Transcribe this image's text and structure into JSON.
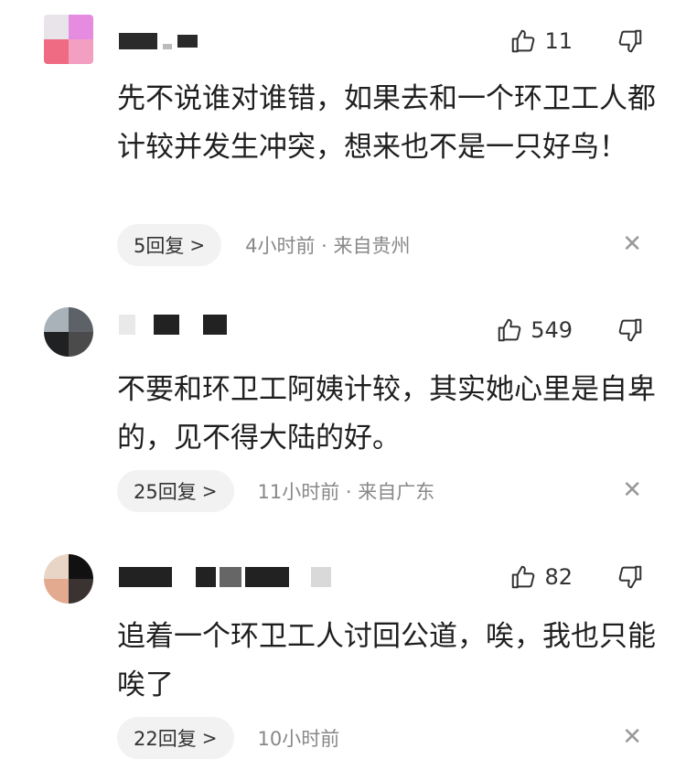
{
  "comments": [
    {
      "likes": "11",
      "text": "先不说谁对谁错，如果去和一个环卫工人都计较并发生冲突，想来也不是一只好鸟！",
      "reply_label": "5回复",
      "meta": "4小时前 · 来自贵州"
    },
    {
      "likes": "549",
      "text": "不要和环卫工阿姨计较，其实她心里是自卑的，见不得大陆的好。",
      "reply_label": "25回复",
      "meta": "11小时前 · 来自广东"
    },
    {
      "likes": "82",
      "text": "追着一个环卫工人讨回公道，唉，我也只能唉了",
      "reply_label": "22回复",
      "meta": "10小时前"
    }
  ],
  "icons": {
    "like": "thumb-up-icon",
    "dislike": "thumb-down-icon",
    "reply_chevron": "chevron-right-icon",
    "close": "close-icon"
  },
  "colors": {
    "reply_bg": "#f2f2f2",
    "meta_text": "#888888",
    "avatar1": [
      "#e9e3ea",
      "#e58ce0",
      "#ee6b83",
      "#f39fc1"
    ],
    "avatar2": [
      "#a9b2b9",
      "#5d6269",
      "#1f2123",
      "#4b4b4b"
    ],
    "avatar3": [
      "#e8d5c6",
      "#111111",
      "#e4aa90",
      "#3a3332"
    ]
  }
}
